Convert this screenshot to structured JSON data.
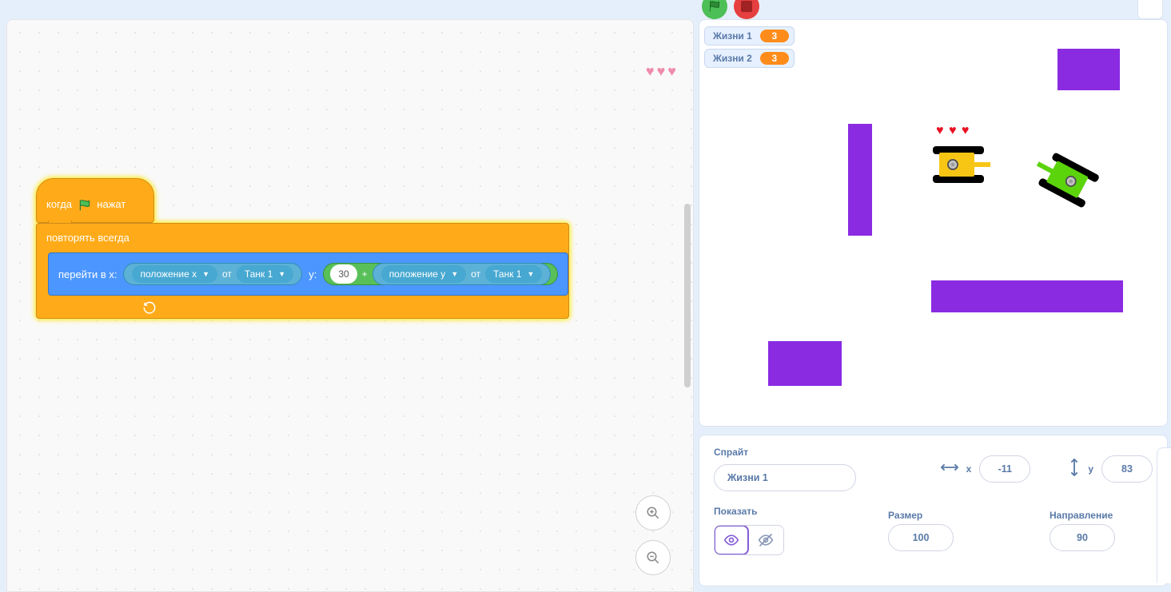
{
  "topbar": {
    "green_flag": "green-flag",
    "stop": "stop",
    "more": "⋯"
  },
  "code": {
    "hat_prefix": "когда",
    "hat_suffix": "нажат",
    "forever": "повторять всегда",
    "goto_x": "перейти в x:",
    "y": "y:",
    "pos_x": "положение x",
    "pos_y": "положение y",
    "of": "от",
    "tank1": "Танк 1",
    "plus_val": "30",
    "plus": "+"
  },
  "hearts_topright": "♥ ♥ ♥",
  "stage": {
    "var1_label": "Жизни 1",
    "var1_val": "3",
    "var2_label": "Жизни 2",
    "var2_val": "3",
    "hearts": "♥ ♥ ♥"
  },
  "sprite_info": {
    "sprite_label": "Спрайт",
    "sprite_name": "Жизни 1",
    "x_label": "x",
    "x_val": "-11",
    "y_label": "y",
    "y_val": "83",
    "show_label": "Показать",
    "size_label": "Размер",
    "size_val": "100",
    "dir_label": "Направление",
    "dir_val": "90"
  },
  "zoom": {
    "in": "+",
    "out": "−"
  }
}
